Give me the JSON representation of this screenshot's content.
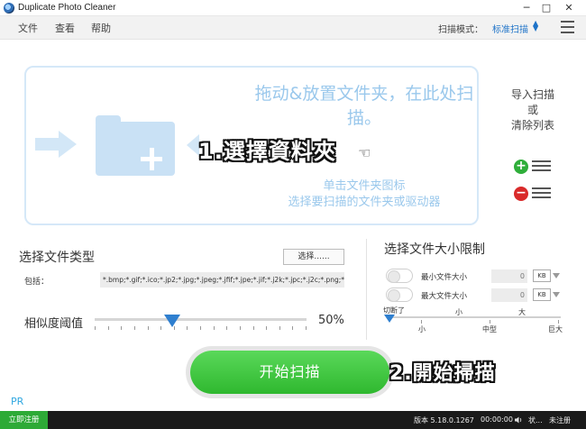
{
  "window": {
    "title": "Duplicate Photo Cleaner",
    "controls": {
      "minimize": "─",
      "maximize": "□",
      "close": "✕"
    }
  },
  "menu": {
    "items": [
      "文件",
      "查看",
      "帮助"
    ],
    "scan_mode_label": "扫描模式：",
    "scan_mode_value": "标准扫描"
  },
  "dropzone": {
    "title": "拖动&放置文件夹，在此处扫描。",
    "hint_line1": "单击文件夹图标",
    "hint_line2": "选择要扫描的文件夹或驱动器",
    "annotation": "1.選擇資料夾"
  },
  "import": {
    "line1": "导入扫描",
    "line2": "或",
    "line3": "清除列表",
    "add_glyph": "+",
    "remove_glyph": "−"
  },
  "file_types": {
    "title": "选择文件类型",
    "choose_button": "选择......",
    "include_label": "包括：",
    "include_value": "*.bmp;*.gif;*.ico;*.jp2;*.jpg;*.jpeg;*.jfif;*.jpe;*.jif;*.j2k;*.jpc;*.j2c;*.png;*.tif;*.tiff;*.tg"
  },
  "similarity": {
    "label": "相似度阈值",
    "value": "50%",
    "level": 0.5
  },
  "size_limit": {
    "title": "选择文件大小限制",
    "min_label": "最小文件大小",
    "min_value": "0",
    "min_unit": "KB",
    "max_label": "最大文件大小",
    "max_value": "0",
    "max_unit": "KB",
    "scale": [
      "切断了",
      "小",
      "小",
      "中型",
      "大",
      "巨大"
    ]
  },
  "start": {
    "label": "开始扫描",
    "annotation": "2.開始掃描"
  },
  "footer": {
    "pr": "PR"
  },
  "status": {
    "register": "立即注册",
    "version": "版本 5.18.0.1267",
    "time": "00:00:00",
    "state": "状...",
    "license": "未注册"
  }
}
